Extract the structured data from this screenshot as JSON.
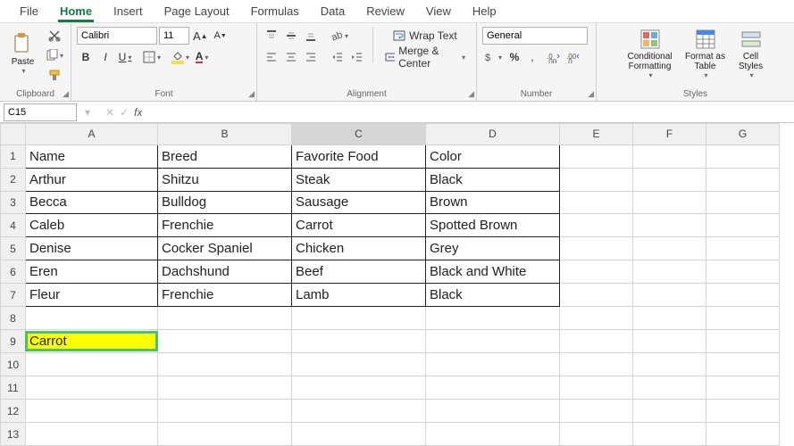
{
  "menu": {
    "tabs": [
      "File",
      "Home",
      "Insert",
      "Page Layout",
      "Formulas",
      "Data",
      "Review",
      "View",
      "Help"
    ],
    "active": "Home"
  },
  "ribbon": {
    "clipboard": {
      "label": "Clipboard",
      "paste": "Paste"
    },
    "font": {
      "label": "Font",
      "name": "Calibri",
      "size": "11",
      "bold": "B",
      "italic": "I",
      "underline": "U"
    },
    "alignment": {
      "label": "Alignment",
      "wrap": "Wrap Text",
      "merge": "Merge & Center"
    },
    "number": {
      "label": "Number",
      "format": "General"
    },
    "styles": {
      "label": "Styles",
      "cond": "Conditional Formatting",
      "table": "Format as Table",
      "cell": "Cell Styles"
    }
  },
  "namebox": {
    "ref": "C15"
  },
  "formula": {
    "value": ""
  },
  "columns": [
    "A",
    "B",
    "C",
    "D",
    "E",
    "F",
    "G"
  ],
  "rows": [
    "1",
    "2",
    "3",
    "4",
    "5",
    "6",
    "7",
    "8",
    "9",
    "10",
    "11",
    "12",
    "13"
  ],
  "data": {
    "headers": [
      "Name",
      "Breed",
      "Favorite Food",
      "Color"
    ],
    "rows": [
      [
        "Arthur",
        "Shitzu",
        "Steak",
        "Black"
      ],
      [
        "Becca",
        "Bulldog",
        "Sausage",
        "Brown"
      ],
      [
        "Caleb",
        "Frenchie",
        "Carrot",
        "Spotted Brown"
      ],
      [
        "Denise",
        "Cocker Spaniel",
        "Chicken",
        "Grey"
      ],
      [
        "Eren",
        "Dachshund",
        "Beef",
        "Black and White"
      ],
      [
        "Fleur",
        "Frenchie",
        "Lamb",
        "Black"
      ]
    ]
  },
  "highlight": {
    "A9": "Carrot"
  }
}
